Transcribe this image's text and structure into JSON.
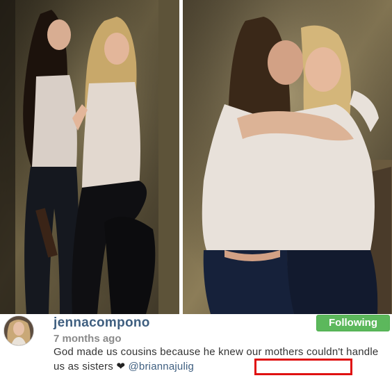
{
  "post": {
    "username": "jennacompono",
    "timestamp": "7 months ago",
    "follow_label": "Following",
    "caption": {
      "text": "God made us cousins because he knew our mothers couldn't handle us as sisters",
      "emoji": "❤",
      "emoji_name": "heart-icon",
      "mention": "@briannajulig"
    }
  },
  "photos": {
    "left": {
      "subject": "two women posing in front of a gold wall"
    },
    "right": {
      "subject": "two women hugging and smiling"
    }
  },
  "colors": {
    "username": "#3f5f80",
    "follow_button": "#5cb85c",
    "timestamp": "#8a8a8a",
    "highlight": "#e01010"
  }
}
